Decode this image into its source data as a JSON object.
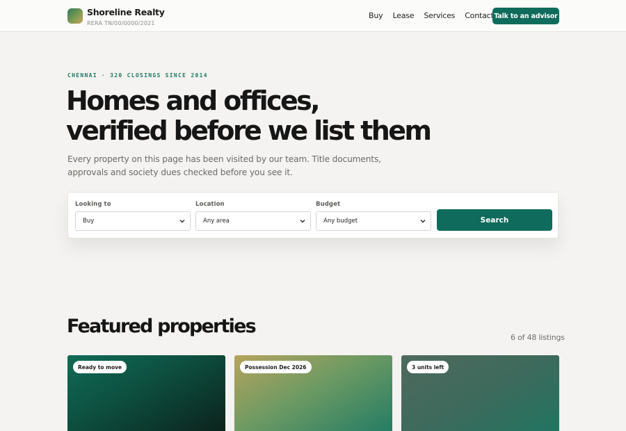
{
  "header": {
    "brand_name": "Shoreline Realty",
    "brand_sub": "RERA TN/00/0000/2021",
    "nav": [
      "Buy",
      "Lease",
      "Services",
      "Contact"
    ],
    "cta_label": "Talk to an advisor"
  },
  "hero": {
    "eyebrow": "CHENNAI · 320 CLOSINGS SINCE 2014",
    "headline_line1": "Homes and offices,",
    "headline_line2": "verified before we list them",
    "lede": "Every property on this page has been visited by our team. Title documents, approvals and society dues checked before you see it."
  },
  "search": {
    "fields": [
      {
        "label": "Looking to",
        "value": "Buy"
      },
      {
        "label": "Location",
        "value": "Any area"
      },
      {
        "label": "Budget",
        "value": "Any budget"
      }
    ],
    "button_label": "Search"
  },
  "featured": {
    "title": "Featured properties",
    "count": "6 of 48 listings",
    "cards": [
      {
        "badge": "Ready to move"
      },
      {
        "badge": "Possession Dec 2026"
      },
      {
        "badge": "3 units left"
      }
    ]
  },
  "colors": {
    "accent": "#0f6b5b",
    "background": "#f4f3f1",
    "eyebrow": "#1d7863"
  },
  "icons": [
    "logo-mark",
    "chevron-down-icon"
  ]
}
